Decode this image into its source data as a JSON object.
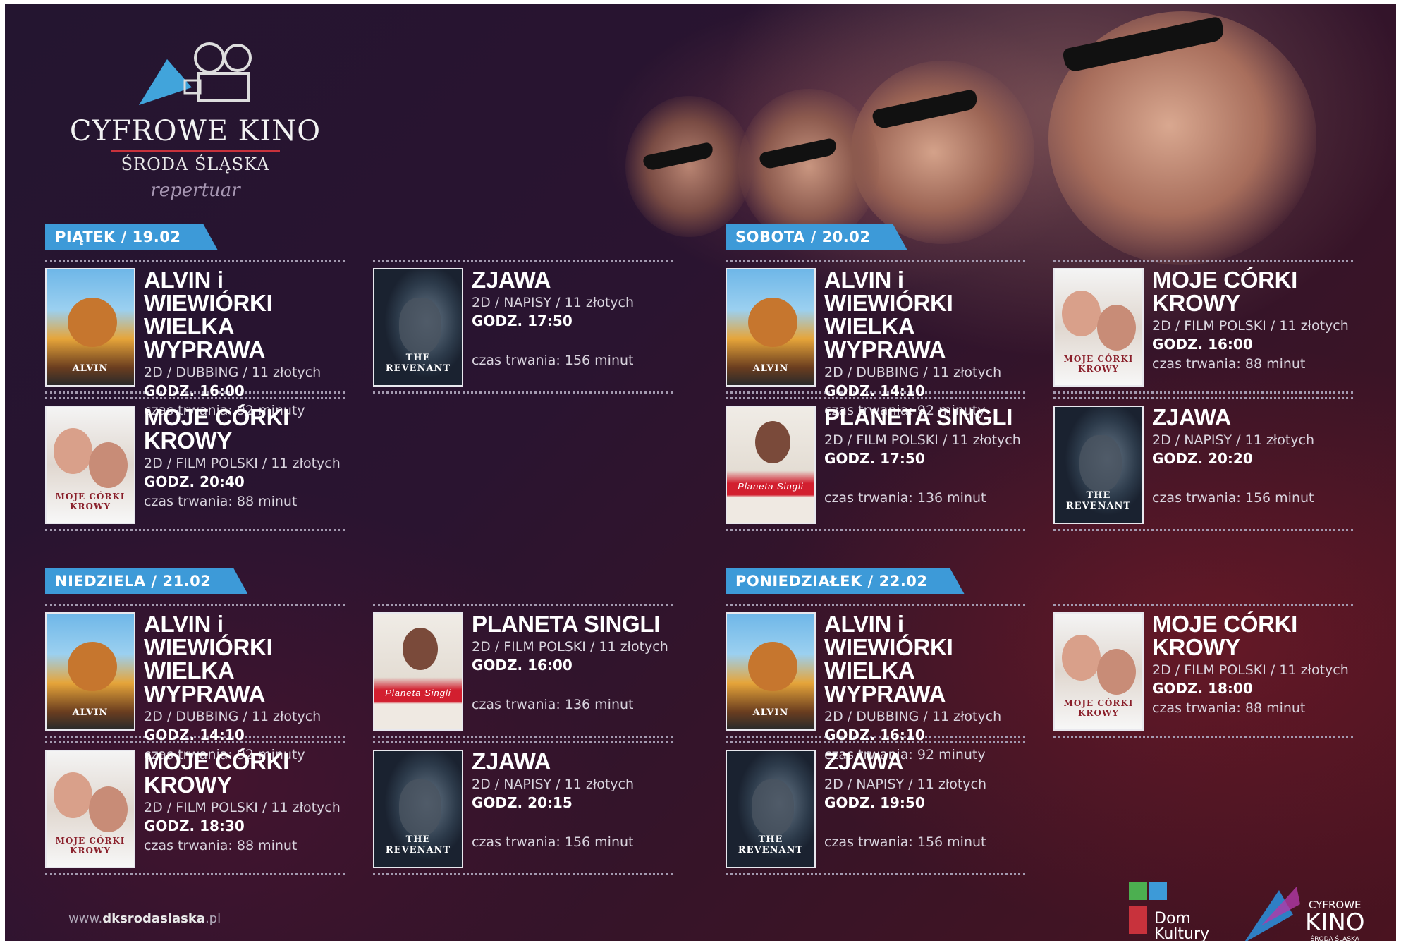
{
  "logo": {
    "title": "CYFROWE KINO",
    "subtitle": "ŚRODA ŚLĄSKA",
    "script": "repertuar"
  },
  "colors": {
    "accent": "#3d9ad8",
    "logo_line": "#c8323c",
    "text": "#ffffff"
  },
  "days": [
    {
      "label": "PIĄTEK / 19.02",
      "movies": [
        {
          "poster": "alvin",
          "poster_text": "ALVIN",
          "title_lines": [
            "ALVIN i WIEWIÓRKI",
            "WIELKA WYPRAWA"
          ],
          "meta": "2D / DUBBING / 11 złotych",
          "time": "GODZ. 16:00",
          "duration": "czas trwania: 92 minuty"
        },
        {
          "poster": "zjawa",
          "poster_text": "THE REVENANT",
          "title_lines": [
            "ZJAWA"
          ],
          "meta": "2D / NAPISY / 11 złotych",
          "time": "GODZ. 17:50",
          "duration": "czas trwania: 156 minut"
        },
        {
          "poster": "krowy",
          "poster_text": "MOJE CÓRKI KROWY",
          "title_lines": [
            "MOJE CÓRKI",
            "KROWY"
          ],
          "meta": "2D / FILM POLSKI / 11 złotych",
          "time": "GODZ. 20:40",
          "duration": "czas trwania: 88 minut"
        }
      ]
    },
    {
      "label": "SOBOTA / 20.02",
      "movies": [
        {
          "poster": "alvin",
          "poster_text": "ALVIN",
          "title_lines": [
            "ALVIN i WIEWIÓRKI",
            "WIELKA WYPRAWA"
          ],
          "meta": "2D / DUBBING / 11 złotych",
          "time": "GODZ. 14:10",
          "duration": "czas trwania: 92 minuty"
        },
        {
          "poster": "krowy",
          "poster_text": "MOJE CÓRKI KROWY",
          "title_lines": [
            "MOJE CÓRKI",
            "KROWY"
          ],
          "meta": "2D / FILM POLSKI / 11 złotych",
          "time": "GODZ. 16:00",
          "duration": "czas trwania: 88 minut"
        },
        {
          "poster": "planeta",
          "poster_text": "Planeta Singli",
          "title_lines": [
            "PLANETA SINGLI"
          ],
          "meta": "2D / FILM POLSKI / 11 złotych",
          "time": "GODZ. 17:50",
          "duration": "czas trwania: 136 minut"
        },
        {
          "poster": "zjawa",
          "poster_text": "THE REVENANT",
          "title_lines": [
            "ZJAWA"
          ],
          "meta": "2D / NAPISY / 11 złotych",
          "time": "GODZ. 20:20",
          "duration": "czas trwania: 156 minut"
        }
      ]
    },
    {
      "label": "NIEDZIELA / 21.02",
      "movies": [
        {
          "poster": "alvin",
          "poster_text": "ALVIN",
          "title_lines": [
            "ALVIN i WIEWIÓRKI",
            "WIELKA WYPRAWA"
          ],
          "meta": "2D / DUBBING / 11 złotych",
          "time": "GODZ. 14:10",
          "duration": "czas trwania: 92 minuty"
        },
        {
          "poster": "planeta",
          "poster_text": "Planeta Singli",
          "title_lines": [
            "PLANETA SINGLI"
          ],
          "meta": "2D / FILM POLSKI / 11 złotych",
          "time": "GODZ. 16:00",
          "duration": "czas trwania: 136 minut"
        },
        {
          "poster": "krowy",
          "poster_text": "MOJE CÓRKI KROWY",
          "title_lines": [
            "MOJE CÓRKI",
            "KROWY"
          ],
          "meta": "2D / FILM POLSKI / 11 złotych",
          "time": "GODZ. 18:30",
          "duration": "czas trwania: 88 minut"
        },
        {
          "poster": "zjawa",
          "poster_text": "THE REVENANT",
          "title_lines": [
            "ZJAWA"
          ],
          "meta": "2D / NAPISY / 11 złotych",
          "time": "GODZ. 20:15",
          "duration": "czas trwania: 156 minut"
        }
      ]
    },
    {
      "label": "PONIEDZIAŁEK / 22.02",
      "movies": [
        {
          "poster": "alvin",
          "poster_text": "ALVIN",
          "title_lines": [
            "ALVIN i WIEWIÓRKI",
            "WIELKA WYPRAWA"
          ],
          "meta": "2D / DUBBING / 11 złotych",
          "time": "GODZ. 16:10",
          "duration": "czas trwania: 92 minuty"
        },
        {
          "poster": "krowy",
          "poster_text": "MOJE CÓRKI KROWY",
          "title_lines": [
            "MOJE CÓRKI",
            "KROWY"
          ],
          "meta": "2D / FILM POLSKI / 11 złotych",
          "time": "GODZ. 18:00",
          "duration": "czas trwania: 88 minut"
        },
        {
          "poster": "zjawa",
          "poster_text": "THE REVENANT",
          "title_lines": [
            "ZJAWA"
          ],
          "meta": "2D / NAPISY / 11 złotych",
          "time": "GODZ. 19:50",
          "duration": "czas trwania: 156 minut"
        }
      ]
    }
  ],
  "footer": {
    "website_prefix": "www.",
    "website_main": "dksrodaslaska",
    "website_suffix": ".pl",
    "dom_kultury": "Dom Kultury",
    "ck_line1": "CYFROWE",
    "ck_line2": "KINO",
    "ck_line3": "ŚRODA ŚLĄSKA"
  }
}
